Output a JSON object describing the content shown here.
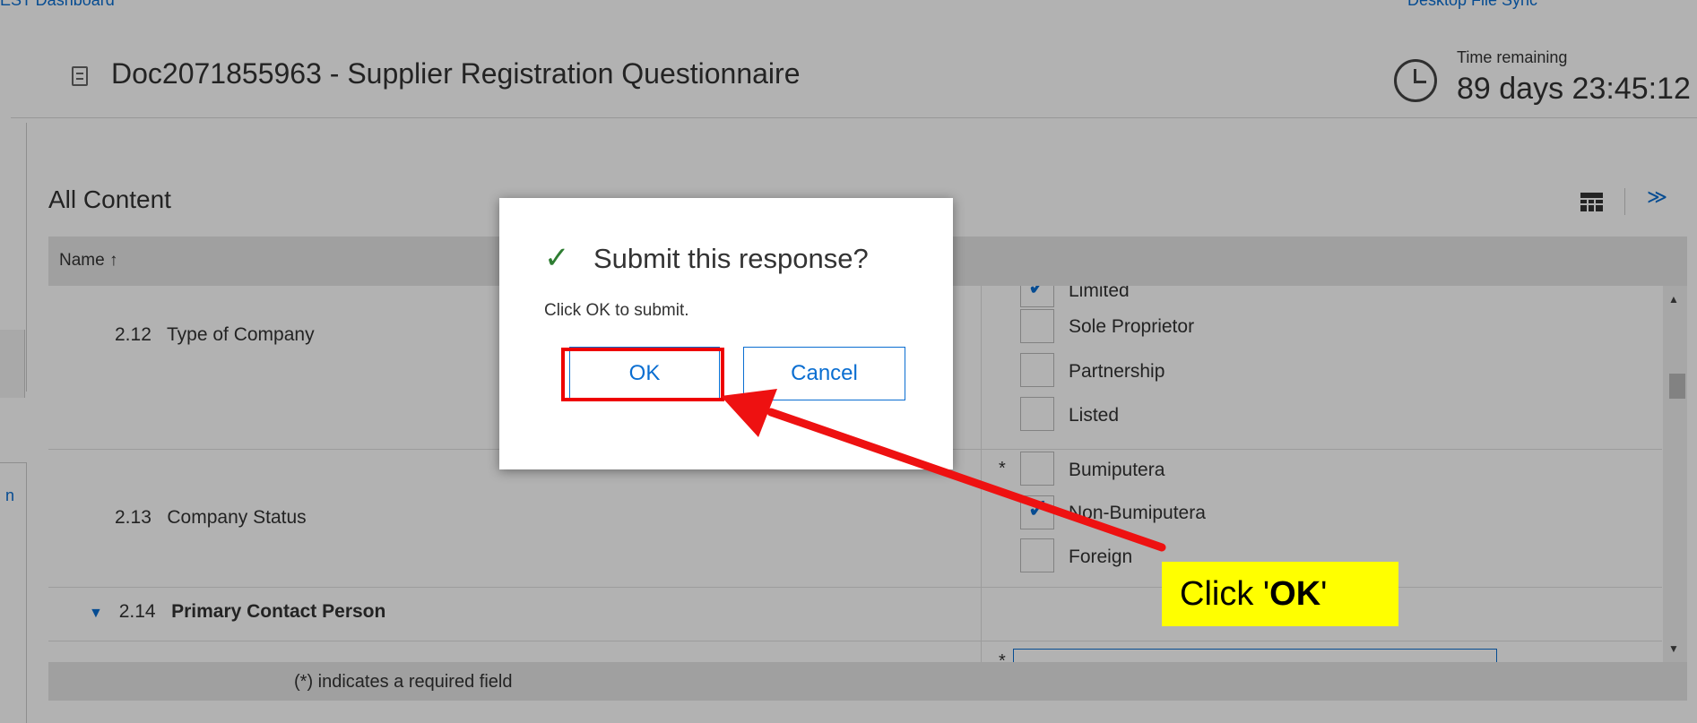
{
  "topbar": {
    "left_link": "EST Dashboard",
    "right_link": "Desktop File Sync"
  },
  "header": {
    "title": "Doc2071855963 - Supplier Registration Questionnaire",
    "time_label": "Time remaining",
    "time_value": "89 days 23:45:12"
  },
  "left_edge": {
    "partial_text": "n"
  },
  "content": {
    "section_title": "All Content",
    "column_name": "Name ↑",
    "rows": [
      {
        "number": "2.12",
        "label": "Type of Company"
      },
      {
        "number": "2.13",
        "label": "Company Status"
      },
      {
        "number": "2.14",
        "label": "Primary Contact Person"
      }
    ],
    "type_options": [
      {
        "label": "Limited",
        "checked": true
      },
      {
        "label": "Sole Proprietor",
        "checked": false
      },
      {
        "label": "Partnership",
        "checked": false
      },
      {
        "label": "Listed",
        "checked": false
      }
    ],
    "status_options": [
      {
        "label": "Bumiputera",
        "checked": false
      },
      {
        "label": "Non-Bumiputera",
        "checked": true
      },
      {
        "label": "Foreign",
        "checked": false
      }
    ],
    "required_marker": "*",
    "footer_note": "(*) indicates a required field"
  },
  "dialog": {
    "title": "Submit this response?",
    "message": "Click OK to submit.",
    "ok_label": "OK",
    "cancel_label": "Cancel"
  },
  "annotation": {
    "callout_prefix": "Click '",
    "callout_bold": "OK",
    "callout_suffix": "'",
    "highlight_color": "#ee0000",
    "callout_color": "#ffff00"
  },
  "colors": {
    "accent": "#0a6ed1",
    "success": "#2e7d32"
  }
}
